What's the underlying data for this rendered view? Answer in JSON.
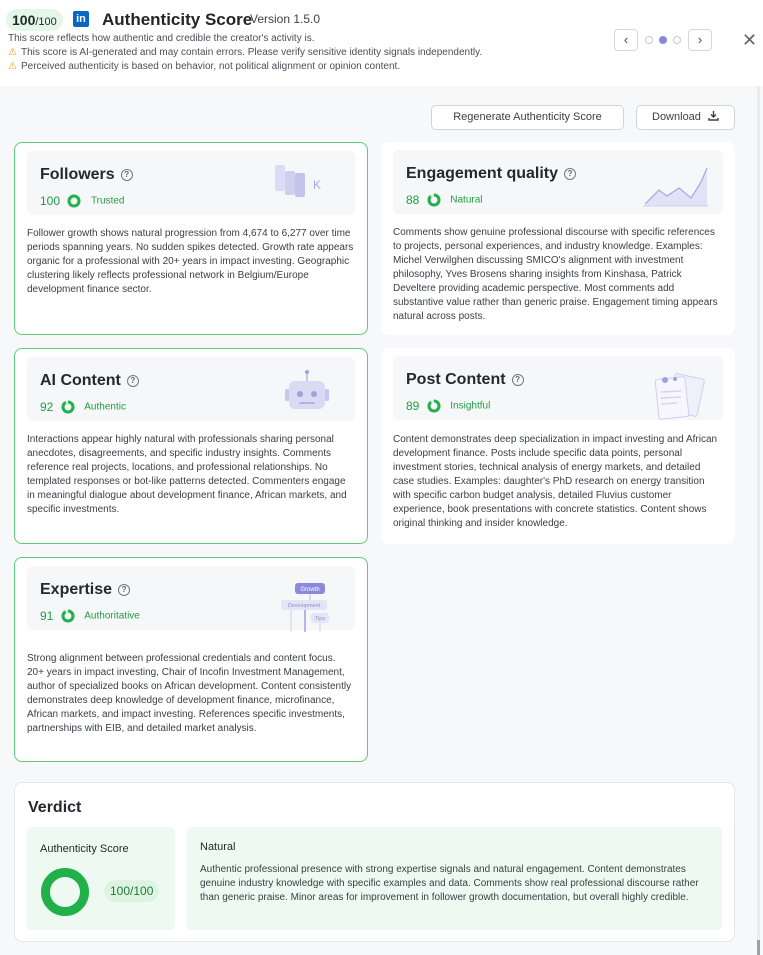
{
  "header": {
    "score": "100",
    "score_den": "/100",
    "title": "Authenticity Score",
    "version": "Version 1.5.0",
    "subtitle": "This score reflects how authentic and credible the creator's activity is.",
    "warnings": [
      "This score is AI-generated and may contain errors. Please verify sensitive identity signals independently.",
      "Perceived authenticity is based on behavior, not political alignment or opinion content."
    ],
    "prev_glyph": "‹",
    "next_glyph": "›",
    "close_glyph": "✕",
    "warn_glyph": "⚠",
    "logo_text": "in"
  },
  "actions": {
    "regenerate": "Regenerate Authenticity Score",
    "download": "Download"
  },
  "cards": [
    {
      "title": "Followers",
      "score": "100",
      "label": "Trusted",
      "fraction": 1.0,
      "illus_text": "K",
      "description": "Follower growth shows natural progression from 4,674 to 6,277 over time periods spanning years. No sudden spikes detected. Growth rate appears organic for a professional with 20+ years in impact investing. Geographic clustering likely reflects professional network in Belgium/Europe development finance sector."
    },
    {
      "title": "Engagement quality",
      "score": "88",
      "label": "Natural",
      "fraction": 0.88,
      "description": "Comments show genuine professional discourse with specific references to projects, personal experiences, and industry knowledge. Examples: Michel Verwilghen discussing SMICO's alignment with investment philosophy, Yves Brosens sharing insights from Kinshasa, Patrick Develtere providing academic perspective. Most comments add substantive value rather than generic praise. Engagement timing appears natural across posts."
    },
    {
      "title": "AI Content",
      "score": "92",
      "label": "Authentic",
      "fraction": 0.92,
      "description": "Interactions appear highly natural with professionals sharing personal anecdotes, disagreements, and specific industry insights. Comments reference real projects, locations, and professional relationships. No templated responses or bot-like patterns detected. Commenters engage in meaningful dialogue about development finance, African markets, and specific investments."
    },
    {
      "title": "Post Content",
      "score": "89",
      "label": "Insightful",
      "fraction": 0.89,
      "description": "Content demonstrates deep specialization in impact investing and African development finance. Posts include specific data points, personal investment stories, technical analysis of energy markets, and detailed case studies. Examples: daughter's PhD research on energy transition with specific carbon budget analysis, detailed Fluvius customer experience, book presentations with concrete statistics. Content shows original thinking and insider knowledge."
    },
    {
      "title": "Expertise",
      "score": "91",
      "label": "Authoritative",
      "fraction": 0.91,
      "illus_labels": [
        "Growth",
        "Development",
        "Tips"
      ],
      "description": "Strong alignment between professional credentials and content focus. 20+ years in impact investing, Chair of Incofin Investment Management, author of specialized books on African development. Content consistently demonstrates deep knowledge of development finance, microfinance, African markets, and impact investing. References specific investments, partnerships with EIB, and detailed market analysis."
    }
  ],
  "verdict": {
    "title": "Verdict",
    "score_label": "Authenticity Score",
    "score_value": "100/100",
    "fraction": 1.0,
    "result_title": "Natural",
    "result_desc": "Authentic professional presence with strong expertise signals and natural engagement. Content demonstrates genuine industry knowledge with specific examples and data. Comments show real professional discourse rather than generic praise. Minor areas for improvement in follower growth documentation, but overall highly credible."
  },
  "colors": {
    "accent_green": "#22b04b",
    "ring_track": "#d6f0dd",
    "linkedin_blue": "#0a66c2",
    "warning": "#e8a21b",
    "carousel_active": "#8a86e0"
  }
}
